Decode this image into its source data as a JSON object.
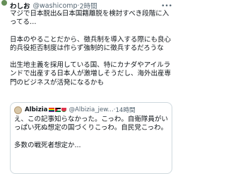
{
  "tweet": {
    "author_name": "わしお",
    "handle": "@washicomp",
    "separator": " · ",
    "time": "2時間",
    "more_icon": "more-icon",
    "text": "マジで日本脱出&日本国籍離脱を検討すべき段階に入ってる…\n\n日本のやることだから、徴兵制を導入する際にも良心的兵役拒否制度は作らず強制的に徴兵するだろうな\n\n出生地主義を採用している国、特にカナダやアイルランドで出産する日本人が激増しそうだし、海外出産専門のビジネスが活発になるかも"
  },
  "quote": {
    "author_name": "Albizia",
    "flags": [
      "rainbow-flag",
      "palestine-flag",
      "watermelon-emoji"
    ],
    "handle": "@Albizia_jew...",
    "separator": " · ",
    "time": "14時間",
    "text": "え、この記事知らなかった。こっわ。自衛隊員がいっぱい死ぬ想定の国づくりこっわ。自民党こっわ。\n\n多数の戦死者想定か..."
  }
}
